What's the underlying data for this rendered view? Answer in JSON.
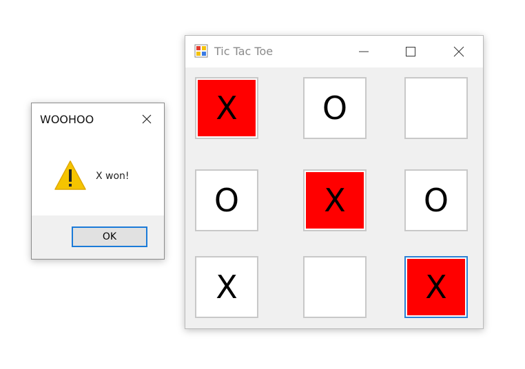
{
  "dialog": {
    "title": "WOOHOO",
    "message": "X won!",
    "ok_label": "OK"
  },
  "window": {
    "title": "Tic Tac Toe"
  },
  "board": {
    "cells": [
      "X",
      "O",
      "",
      "O",
      "X",
      "O",
      "X",
      "",
      "X"
    ],
    "winning_cells": [
      0,
      4,
      8
    ],
    "focused_cell": 8
  },
  "colors": {
    "win_highlight": "#ff0000",
    "focus_border": "#2a7fd4",
    "warning": "#f5c400"
  }
}
